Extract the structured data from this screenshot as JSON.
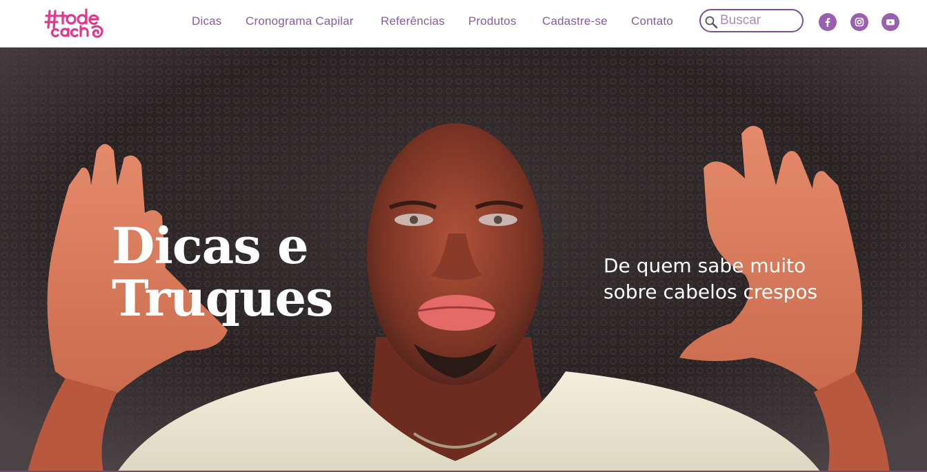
{
  "brand": {
    "logo_text": "#todecacho",
    "primary_color": "#9b5fb0",
    "accent_color": "#e0388a"
  },
  "nav": {
    "items": [
      {
        "label": "Dicas"
      },
      {
        "label": "Cronograma Capilar"
      },
      {
        "label": "Referências"
      },
      {
        "label": "Produtos"
      },
      {
        "label": "Cadastre-se"
      },
      {
        "label": "Contato"
      }
    ]
  },
  "search": {
    "placeholder": "Buscar",
    "icon": "search-icon"
  },
  "social": [
    {
      "icon": "facebook-icon"
    },
    {
      "icon": "instagram-icon"
    },
    {
      "icon": "youtube-icon"
    }
  ],
  "hero": {
    "title_line1": "Dicas e",
    "title_line2": "Truques",
    "subtitle_line1": "De quem sabe muito",
    "subtitle_line2": "sobre cabelos crespos"
  }
}
